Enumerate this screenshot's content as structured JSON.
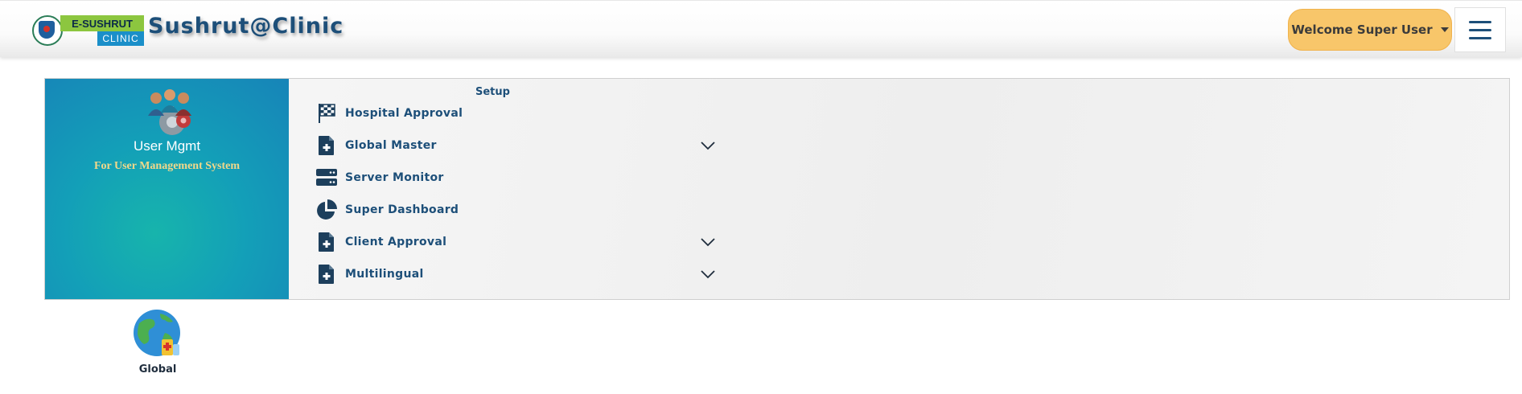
{
  "header": {
    "logo": {
      "top_text": "E-SUSHRUT",
      "bottom_text": "CLINIC"
    },
    "brand_title": "Sushrut@Clinic",
    "user_menu_label": "Welcome Super User",
    "hamburger_icon": "menu-icon"
  },
  "module": {
    "title": "User Mgmt",
    "subtitle": "For User Management System",
    "icon": "users-gear-icon"
  },
  "setup": {
    "section_label": "Setup",
    "items": [
      {
        "label": "Hospital Approval",
        "icon": "checkered-flag-icon",
        "expandable": false
      },
      {
        "label": "Global Master",
        "icon": "file-medical-icon",
        "expandable": true
      },
      {
        "label": "Server Monitor",
        "icon": "server-icon",
        "expandable": false
      },
      {
        "label": "Super Dashboard",
        "icon": "pie-chart-icon",
        "expandable": false
      },
      {
        "label": "Client Approval",
        "icon": "file-medical-icon",
        "expandable": true
      },
      {
        "label": "Multilingual",
        "icon": "file-medical-icon",
        "expandable": true
      }
    ]
  },
  "tiles": [
    {
      "label": "Global",
      "icon": "globe-medical-icon"
    }
  ],
  "colors": {
    "brand_navy": "#1d4f79",
    "user_button": "#f8c66a",
    "module_teal": "#17b4ac",
    "module_blue": "#1784b8",
    "subtitle_gold": "#f2d88a"
  }
}
